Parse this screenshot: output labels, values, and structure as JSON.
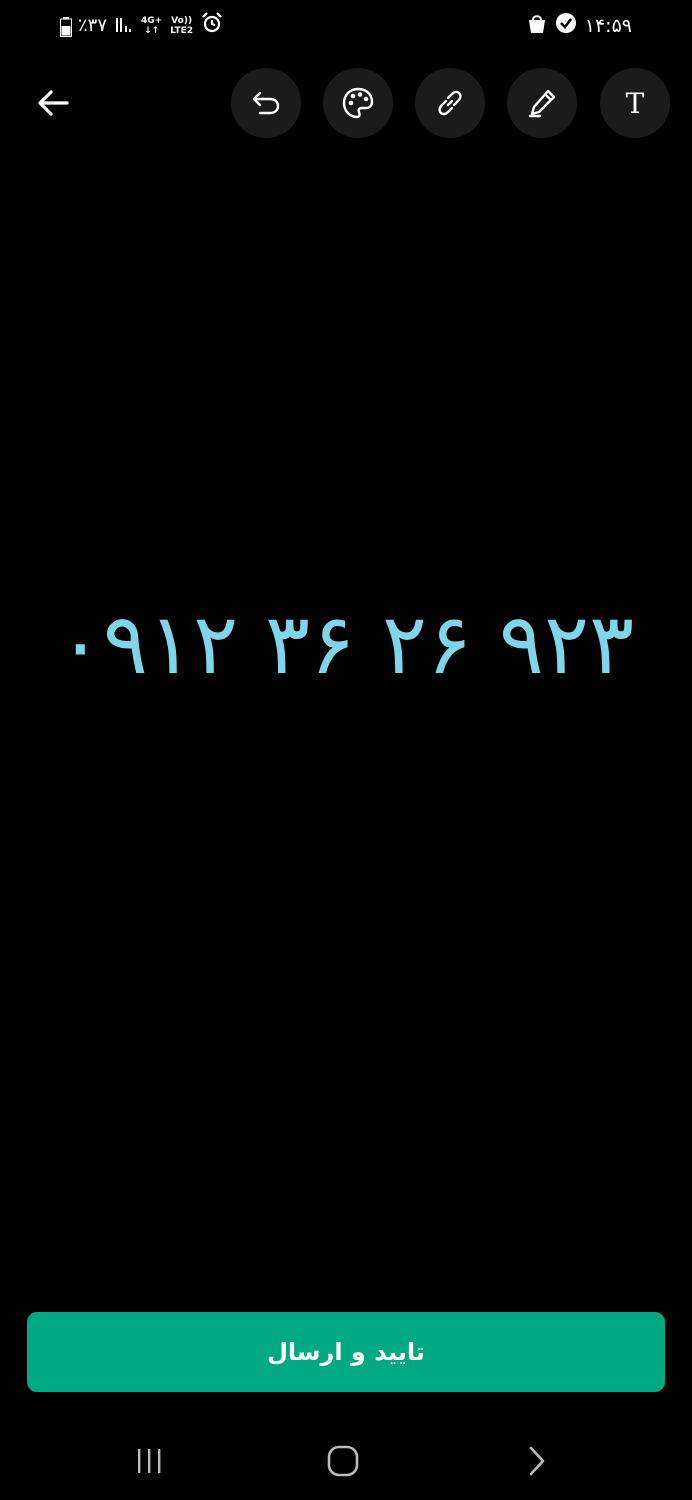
{
  "status_bar": {
    "battery": "٪۳۷",
    "network_top": "4G+",
    "network_bottom": "LTE2",
    "volte": "Vo))",
    "time": "۱۴:۵۹"
  },
  "toolbar": {
    "back_icon": "arrow-left-icon",
    "tools": [
      {
        "name": "undo",
        "icon": "undo-icon"
      },
      {
        "name": "palette",
        "icon": "palette-icon"
      },
      {
        "name": "link",
        "icon": "link-icon"
      },
      {
        "name": "pen",
        "icon": "pen-icon"
      },
      {
        "name": "text",
        "icon": "text-icon",
        "label": "T"
      }
    ]
  },
  "canvas": {
    "text": "۰۹۱۲  ۳۶  ۲۶ ۹۲۳",
    "text_color": "#7fd6ea"
  },
  "confirm_button": {
    "label": "تایید و ارسال",
    "color": "#00a982"
  },
  "nav_bar": {
    "recents_icon": "recents-icon",
    "home_icon": "home-icon",
    "back_icon": "nav-back-icon"
  }
}
